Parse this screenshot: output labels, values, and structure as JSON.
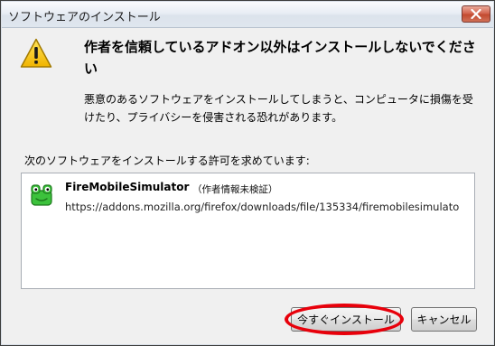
{
  "window": {
    "title": "ソフトウェアのインストール",
    "close_icon": "close-icon"
  },
  "warning": {
    "icon": "warning-icon",
    "headline": "作者を信頼しているアドオン以外はインストールしないでください",
    "description": "悪意のあるソフトウェアをインストールしてしまうと、コンピュータに損傷を受けたり、プライバシーを侵害される恐れがあります。"
  },
  "addons": {
    "caption": "次のソフトウェアをインストールする許可を求めています:",
    "items": [
      {
        "icon": "frog-addon-icon",
        "name": "FireMobileSimulator",
        "author_status": "（作者情報未検証）",
        "url": "https://addons.mozilla.org/firefox/downloads/file/135334/firemobilesimulato"
      }
    ]
  },
  "buttons": {
    "install_label": "今すぐインストール",
    "cancel_label": "キャンセル"
  },
  "colors": {
    "highlight_ring": "#e8000b",
    "warning_yellow": "#f5c400",
    "frog_green": "#3cc23c"
  }
}
